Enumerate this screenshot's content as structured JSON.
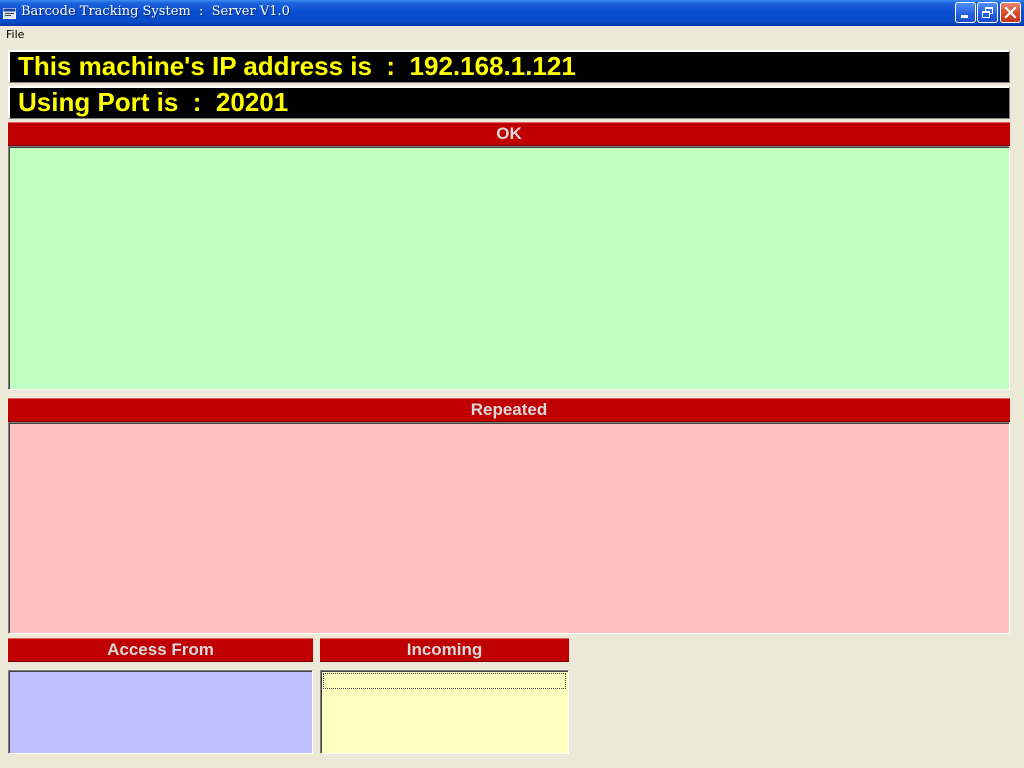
{
  "window": {
    "title": "Barcode Tracking System  :  Server V1.0",
    "icons": {
      "app": "app-window-icon",
      "minimize": "minimize-icon",
      "restore": "restore-icon",
      "close": "close-icon"
    }
  },
  "menu": {
    "items": [
      {
        "label": "File"
      }
    ]
  },
  "info": {
    "ip_line": "This machine's IP address is  :  192.168.1.121",
    "port_line": "Using Port is  :  20201"
  },
  "sections": {
    "ok": {
      "title": "OK",
      "items": []
    },
    "repeated": {
      "title": "Repeated",
      "items": []
    },
    "access_from": {
      "title": "Access From",
      "items": []
    },
    "incoming": {
      "title": "Incoming",
      "items": []
    }
  },
  "colors": {
    "banner_bg": "#000000",
    "banner_text": "#ffff00",
    "header_bg": "#c00000",
    "header_text": "#d9d9d9",
    "ok_panel": "#c0ffc0",
    "repeated_panel": "#ffc0c0",
    "access_panel": "#c0c0ff",
    "incoming_panel": "#ffffc0",
    "window_bg": "#ece9d8"
  }
}
